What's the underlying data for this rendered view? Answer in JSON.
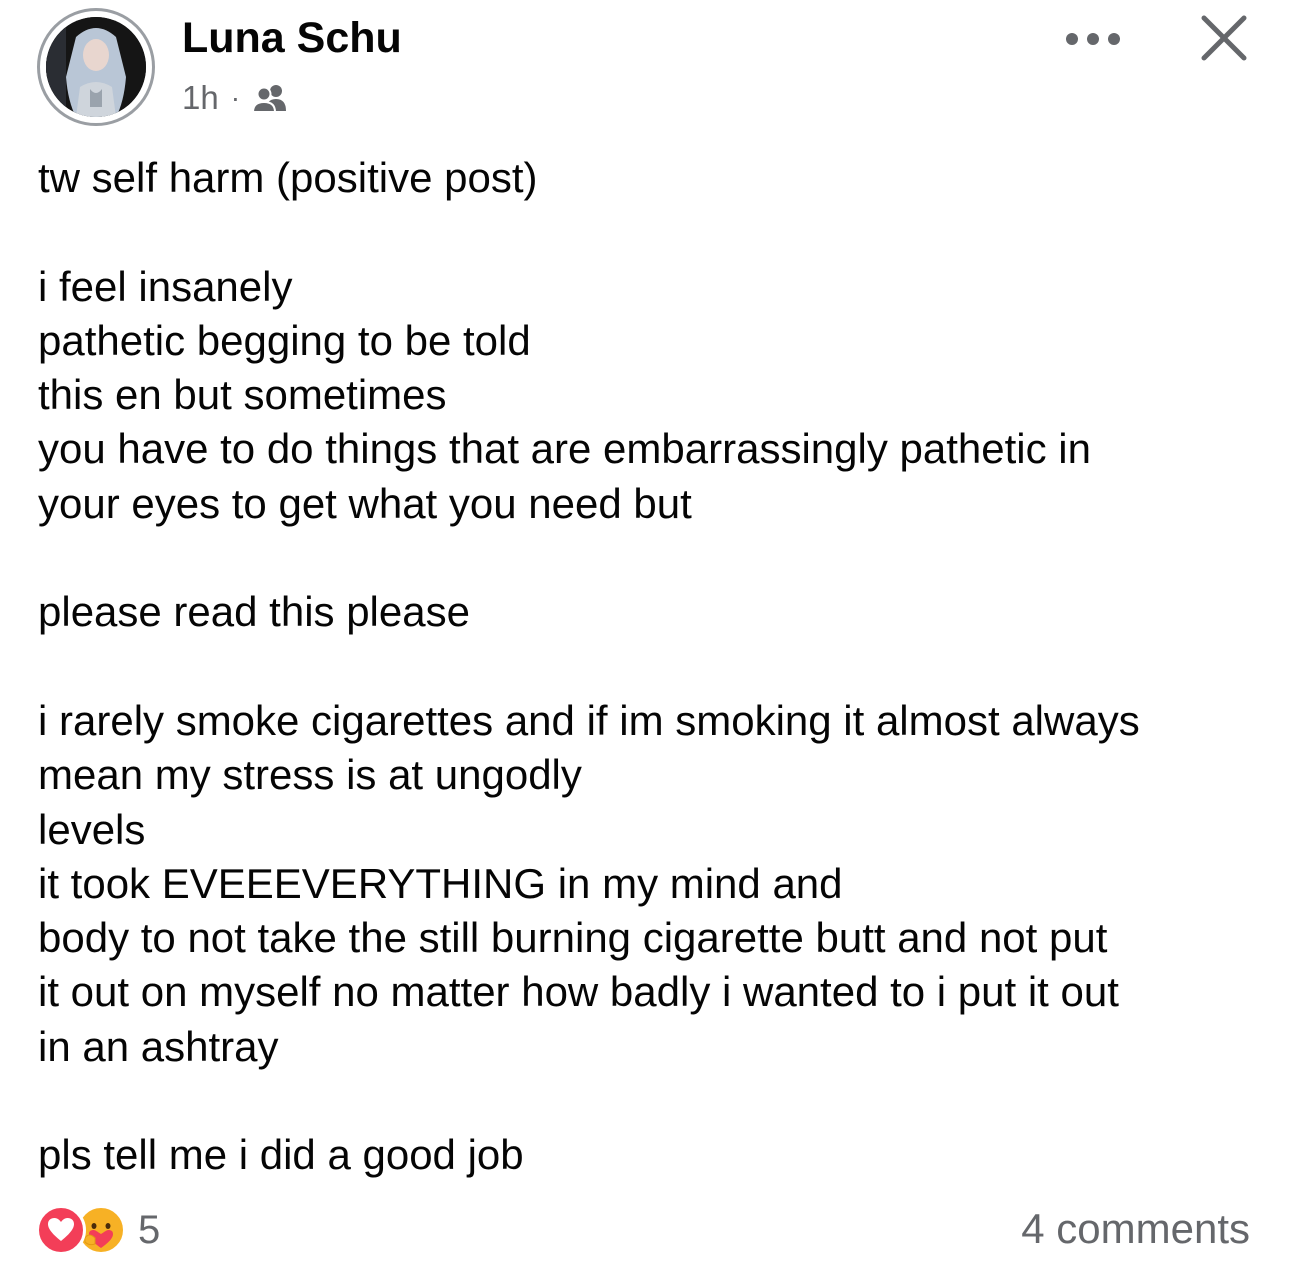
{
  "post": {
    "author": "Luna Schu",
    "timestamp": "1h",
    "separator": "·",
    "audience_icon": "friends-icon",
    "lines": [
      "tw self harm (positive post)",
      "",
      "i feel insanely",
      "pathetic begging to be told",
      "this en but sometimes",
      "you have to do things that are embarrassingly pathetic in",
      "your eyes to get what you need but",
      "",
      "please read this please",
      "",
      "i rarely smoke cigarettes and if im smoking it almost always",
      "mean my stress is at ungodly",
      "levels",
      "it took EVEEEVERYTHING in my mind and",
      "body to not take the still burning cigarette butt and not put",
      "it out on myself no matter how badly i wanted to i put it out",
      "in an ashtray",
      "",
      "pls tell me i did a good job"
    ]
  },
  "footer": {
    "reactions": [
      "love-icon",
      "care-icon"
    ],
    "reaction_count": "5",
    "comments": "4 comments"
  },
  "colors": {
    "text": "#050505",
    "secondary": "#65676b",
    "love": "#f33e58",
    "care": "#f7b125"
  }
}
